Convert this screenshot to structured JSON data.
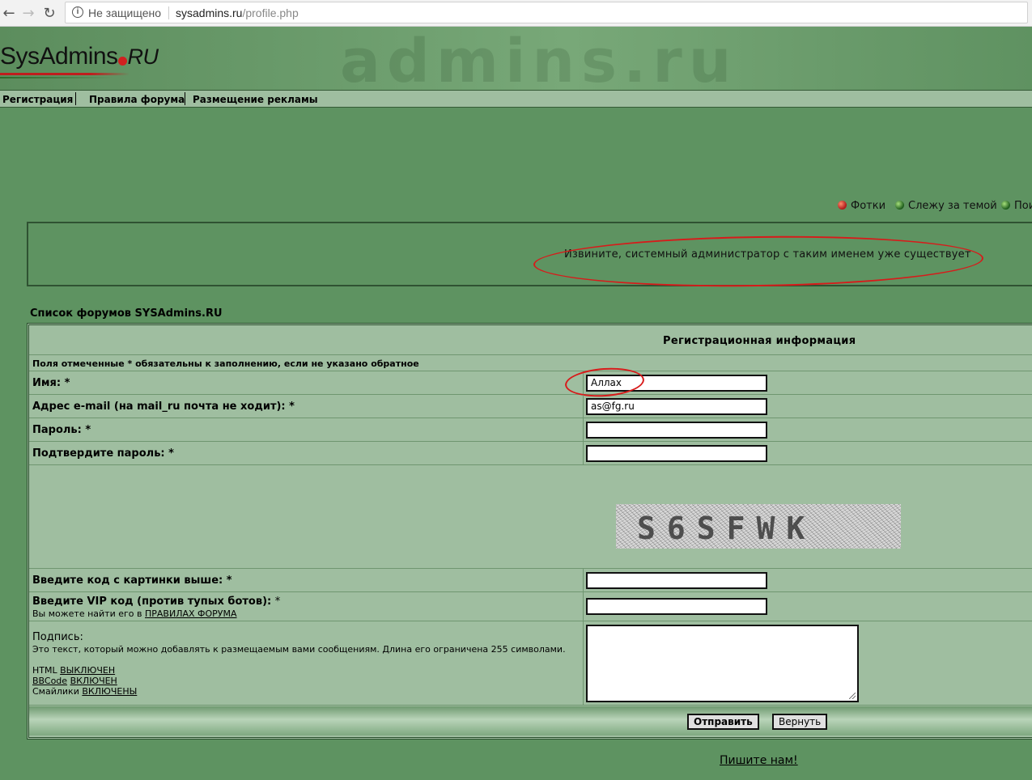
{
  "browser": {
    "security_text": "Не защищено",
    "host": "sysadmins.ru",
    "path": "/profile.php"
  },
  "header": {
    "logo_text": "SysAdmins",
    "logo_ru": "RU",
    "background_letters": "admins.ru"
  },
  "menu": {
    "items": [
      "Регистрация",
      "Правила форума",
      "Размещение рекламы"
    ]
  },
  "quicklinks": {
    "items": [
      "Фотки",
      "Слежу за темой",
      "Пои"
    ]
  },
  "message": {
    "text": "Извините, системный администратор с таким именем уже существует"
  },
  "forum_list_link": "Список форумов SYSAdmins.RU",
  "form": {
    "header": "Регистрационная информация",
    "required_note": "Поля отмеченные * обязательны к заполнению, если не указано обратное",
    "name_label": "Имя: *",
    "name_value": "Аллах",
    "email_label": "Адрес e-mail (на mail_ru почта не ходит): *",
    "email_value": "as@fg.ru",
    "password_label": "Пароль: *",
    "password_value": "",
    "confirm_label": "Подтвердите пароль: *",
    "confirm_value": "",
    "captcha_code": "S6SFWK",
    "captcha_label": "Введите код с картинки выше: *",
    "captcha_value": "",
    "vip_label": "Введите VIP код (против тупых ботов): ",
    "vip_star": "*",
    "vip_hint_prefix": "Вы можете найти его в ",
    "vip_hint_link": "ПРАВИЛАХ ФОРУМА",
    "signature_label": "Подпись:",
    "signature_desc": "Это текст, который можно добавлять к размещаемым вами сообщениям. Длина его ограничена 255 символами.",
    "html_label": "HTML",
    "html_state": "ВЫКЛЮЧЕН",
    "bbcode_label": "BBCode",
    "bbcode_state": "ВКЛЮЧЕН",
    "smilies_label": "Смайлики",
    "smilies_state": "ВКЛЮЧЕНЫ",
    "submit_label": "Отправить",
    "reset_label": "Вернуть"
  },
  "footer": {
    "write_us": "Пишите нам!"
  }
}
